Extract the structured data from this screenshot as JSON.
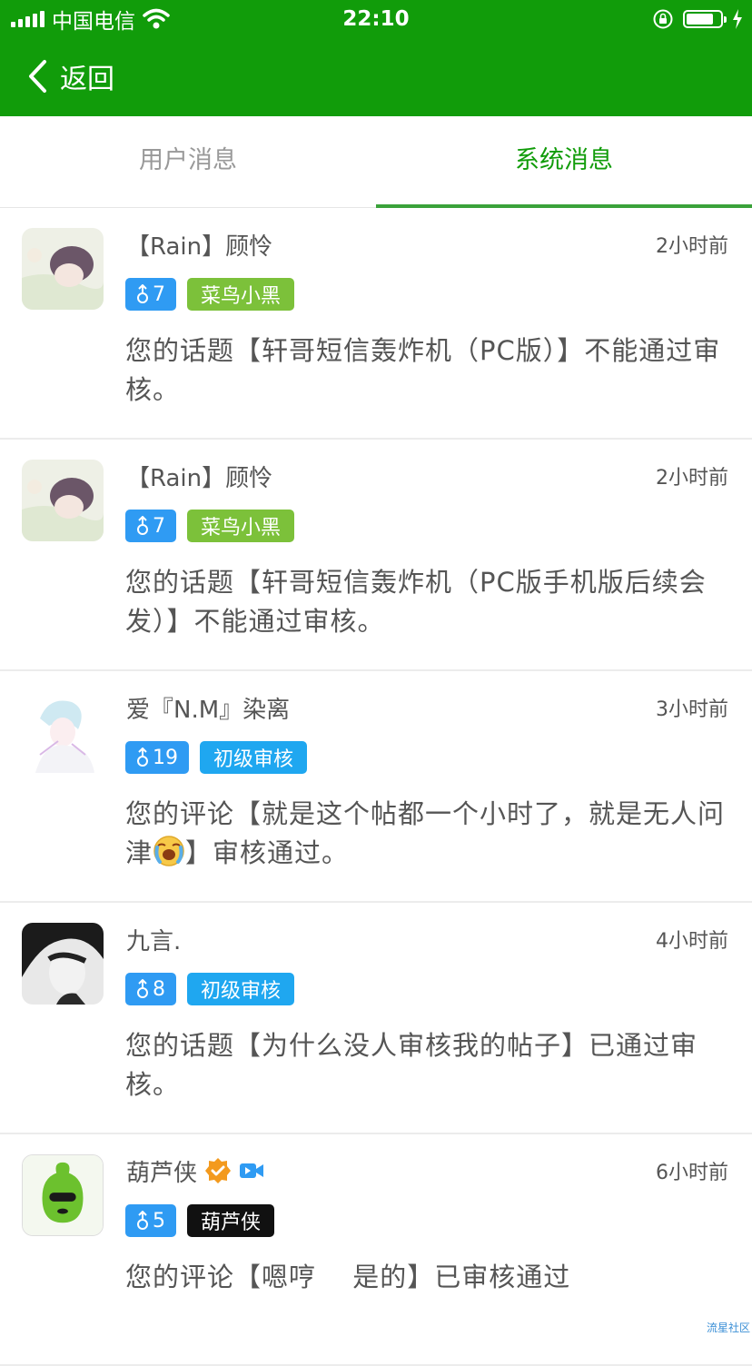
{
  "status_bar": {
    "carrier": "中国电信",
    "time": "22:10"
  },
  "nav": {
    "back_label": "返回"
  },
  "tabs": [
    {
      "label": "用户消息",
      "active": false
    },
    {
      "label": "系统消息",
      "active": true
    }
  ],
  "messages": [
    {
      "username": "【Rain】顾怜",
      "time": "2小时前",
      "level": "7",
      "title_badge": "菜鸟小黑",
      "title_color": "#7cc13a",
      "content": "您的话题【轩哥短信轰炸机（PC版）】不能通过审核。"
    },
    {
      "username": "【Rain】顾怜",
      "time": "2小时前",
      "level": "7",
      "title_badge": "菜鸟小黑",
      "title_color": "#7cc13a",
      "content": "您的话题【轩哥短信轰炸机（PC版手机版后续会发）】不能通过审核。"
    },
    {
      "username": "爱『N.M』染离",
      "time": "3小时前",
      "level": "19",
      "title_badge": "初级审核",
      "title_color": "#1fa7f0",
      "content_before": "您的评论【就是这个帖都一个小时了，就是无人问津",
      "content_after": "】审核通过。"
    },
    {
      "username": "九言.",
      "time": "4小时前",
      "level": "8",
      "title_badge": "初级审核",
      "title_color": "#1fa7f0",
      "content": "您的话题【为什么没人审核我的帖子】已通过审核。"
    },
    {
      "username": "葫芦侠",
      "time": "6小时前",
      "level": "5",
      "title_badge": "葫芦侠",
      "title_color": "#111111",
      "content": "您的评论【嗯哼　 是的】已审核通过"
    }
  ],
  "watermark": "流星社区",
  "colors": {
    "brand_green": "#119c0a",
    "level_blue": "#2f9bf3"
  }
}
